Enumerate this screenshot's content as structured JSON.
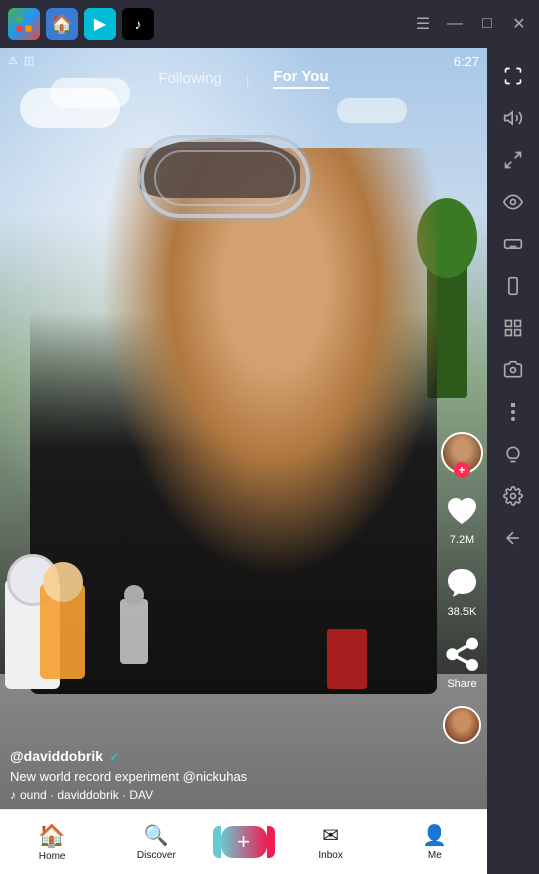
{
  "topbar": {
    "timestamp": "6:27",
    "apps": [
      {
        "name": "layers",
        "label": "Layers"
      },
      {
        "name": "home",
        "label": "Home"
      },
      {
        "name": "play",
        "label": "Play Store"
      },
      {
        "name": "tiktok",
        "label": "TikTok"
      }
    ],
    "window_controls": {
      "menu": "☰",
      "minimize": "—",
      "maximize": "□",
      "close": "✕"
    }
  },
  "right_panel": {
    "icons": [
      {
        "name": "expand-icon",
        "symbol": "⛶"
      },
      {
        "name": "volume-icon",
        "symbol": "🔊"
      },
      {
        "name": "scale-icon",
        "symbol": "⤢"
      },
      {
        "name": "eye-icon",
        "symbol": "◉"
      },
      {
        "name": "keyboard-icon",
        "symbol": "⌨"
      },
      {
        "name": "device-icon",
        "symbol": "▣"
      },
      {
        "name": "grid-icon",
        "symbol": "⊞"
      },
      {
        "name": "capture-icon",
        "symbol": "⎙"
      },
      {
        "name": "more-icon",
        "symbol": "•••"
      },
      {
        "name": "bulb-icon",
        "symbol": "💡"
      },
      {
        "name": "settings-icon",
        "symbol": "⚙"
      },
      {
        "name": "back-icon",
        "symbol": "←"
      }
    ]
  },
  "video": {
    "alert_icons": [
      "⚠",
      "◫"
    ],
    "timestamp": "6:27",
    "tabs": {
      "following": "Following",
      "separator": "|",
      "for_you": "For You",
      "active": "for_you"
    },
    "username": "@daviddobrik",
    "verified": true,
    "description": "New world record experiment @nickuhas",
    "music": "ound · daviddobrik · DAV",
    "music_note": "♪"
  },
  "actions": {
    "follow_badge": "+",
    "likes_count": "7.2M",
    "comments_count": "38.5K",
    "share_label": "Share"
  },
  "bottom_nav": {
    "items": [
      {
        "name": "home",
        "icon": "🏠",
        "label": "Home",
        "active": true
      },
      {
        "name": "discover",
        "icon": "🔍",
        "label": "Discover"
      },
      {
        "name": "create",
        "icon": "+",
        "label": ""
      },
      {
        "name": "inbox",
        "icon": "✉",
        "label": "Inbox"
      },
      {
        "name": "me",
        "icon": "👤",
        "label": "Me"
      }
    ]
  }
}
